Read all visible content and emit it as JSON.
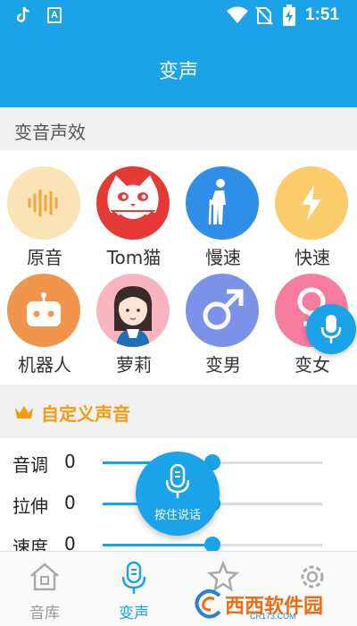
{
  "status_bar": {
    "time": "1:51",
    "notif_letter": "A"
  },
  "header": {
    "title": "变声"
  },
  "effects_section": {
    "title": "变音声效"
  },
  "effects": [
    {
      "label": "原音",
      "icon": "waveform-icon",
      "color": "#fbe3b8"
    },
    {
      "label": "Tom猫",
      "icon": "cat-face-icon",
      "color": "#e53935"
    },
    {
      "label": "慢速",
      "icon": "walking-elder-icon",
      "color": "#2f8ee8"
    },
    {
      "label": "快速",
      "icon": "lightning-icon",
      "color": "#fccb6c"
    },
    {
      "label": "机器人",
      "icon": "robot-icon",
      "color": "#f0954c"
    },
    {
      "label": "萝莉",
      "icon": "girl-avatar-icon",
      "color": "#f8b5bf"
    },
    {
      "label": "变男",
      "icon": "male-symbol-icon",
      "color": "#7b92e8"
    },
    {
      "label": "变女",
      "icon": "female-symbol-icon",
      "color": "#f67ca0"
    }
  ],
  "custom_section": {
    "title": "自定义声音"
  },
  "sliders": [
    {
      "label": "音调",
      "value": "0",
      "fraction": 0.5
    },
    {
      "label": "拉伸",
      "value": "0",
      "fraction": 0.5
    },
    {
      "label": "速度",
      "value": "0",
      "fraction": 0.5
    }
  ],
  "hold_talk": {
    "label": "按住说话"
  },
  "bottom_nav": [
    {
      "label": "音库",
      "icon": "sound-library-icon",
      "active": false
    },
    {
      "label": "变声",
      "icon": "microphone-icon",
      "active": true
    },
    {
      "label": "",
      "icon": "star-icon",
      "active": false
    },
    {
      "label": "",
      "icon": "settings-icon",
      "active": false
    }
  ],
  "watermark": {
    "text": "西西软件园",
    "sub": "CR173.COM"
  },
  "colors": {
    "primary": "#1ba3ea",
    "accent": "#f39c12",
    "section_bg": "#f1f1f1"
  }
}
